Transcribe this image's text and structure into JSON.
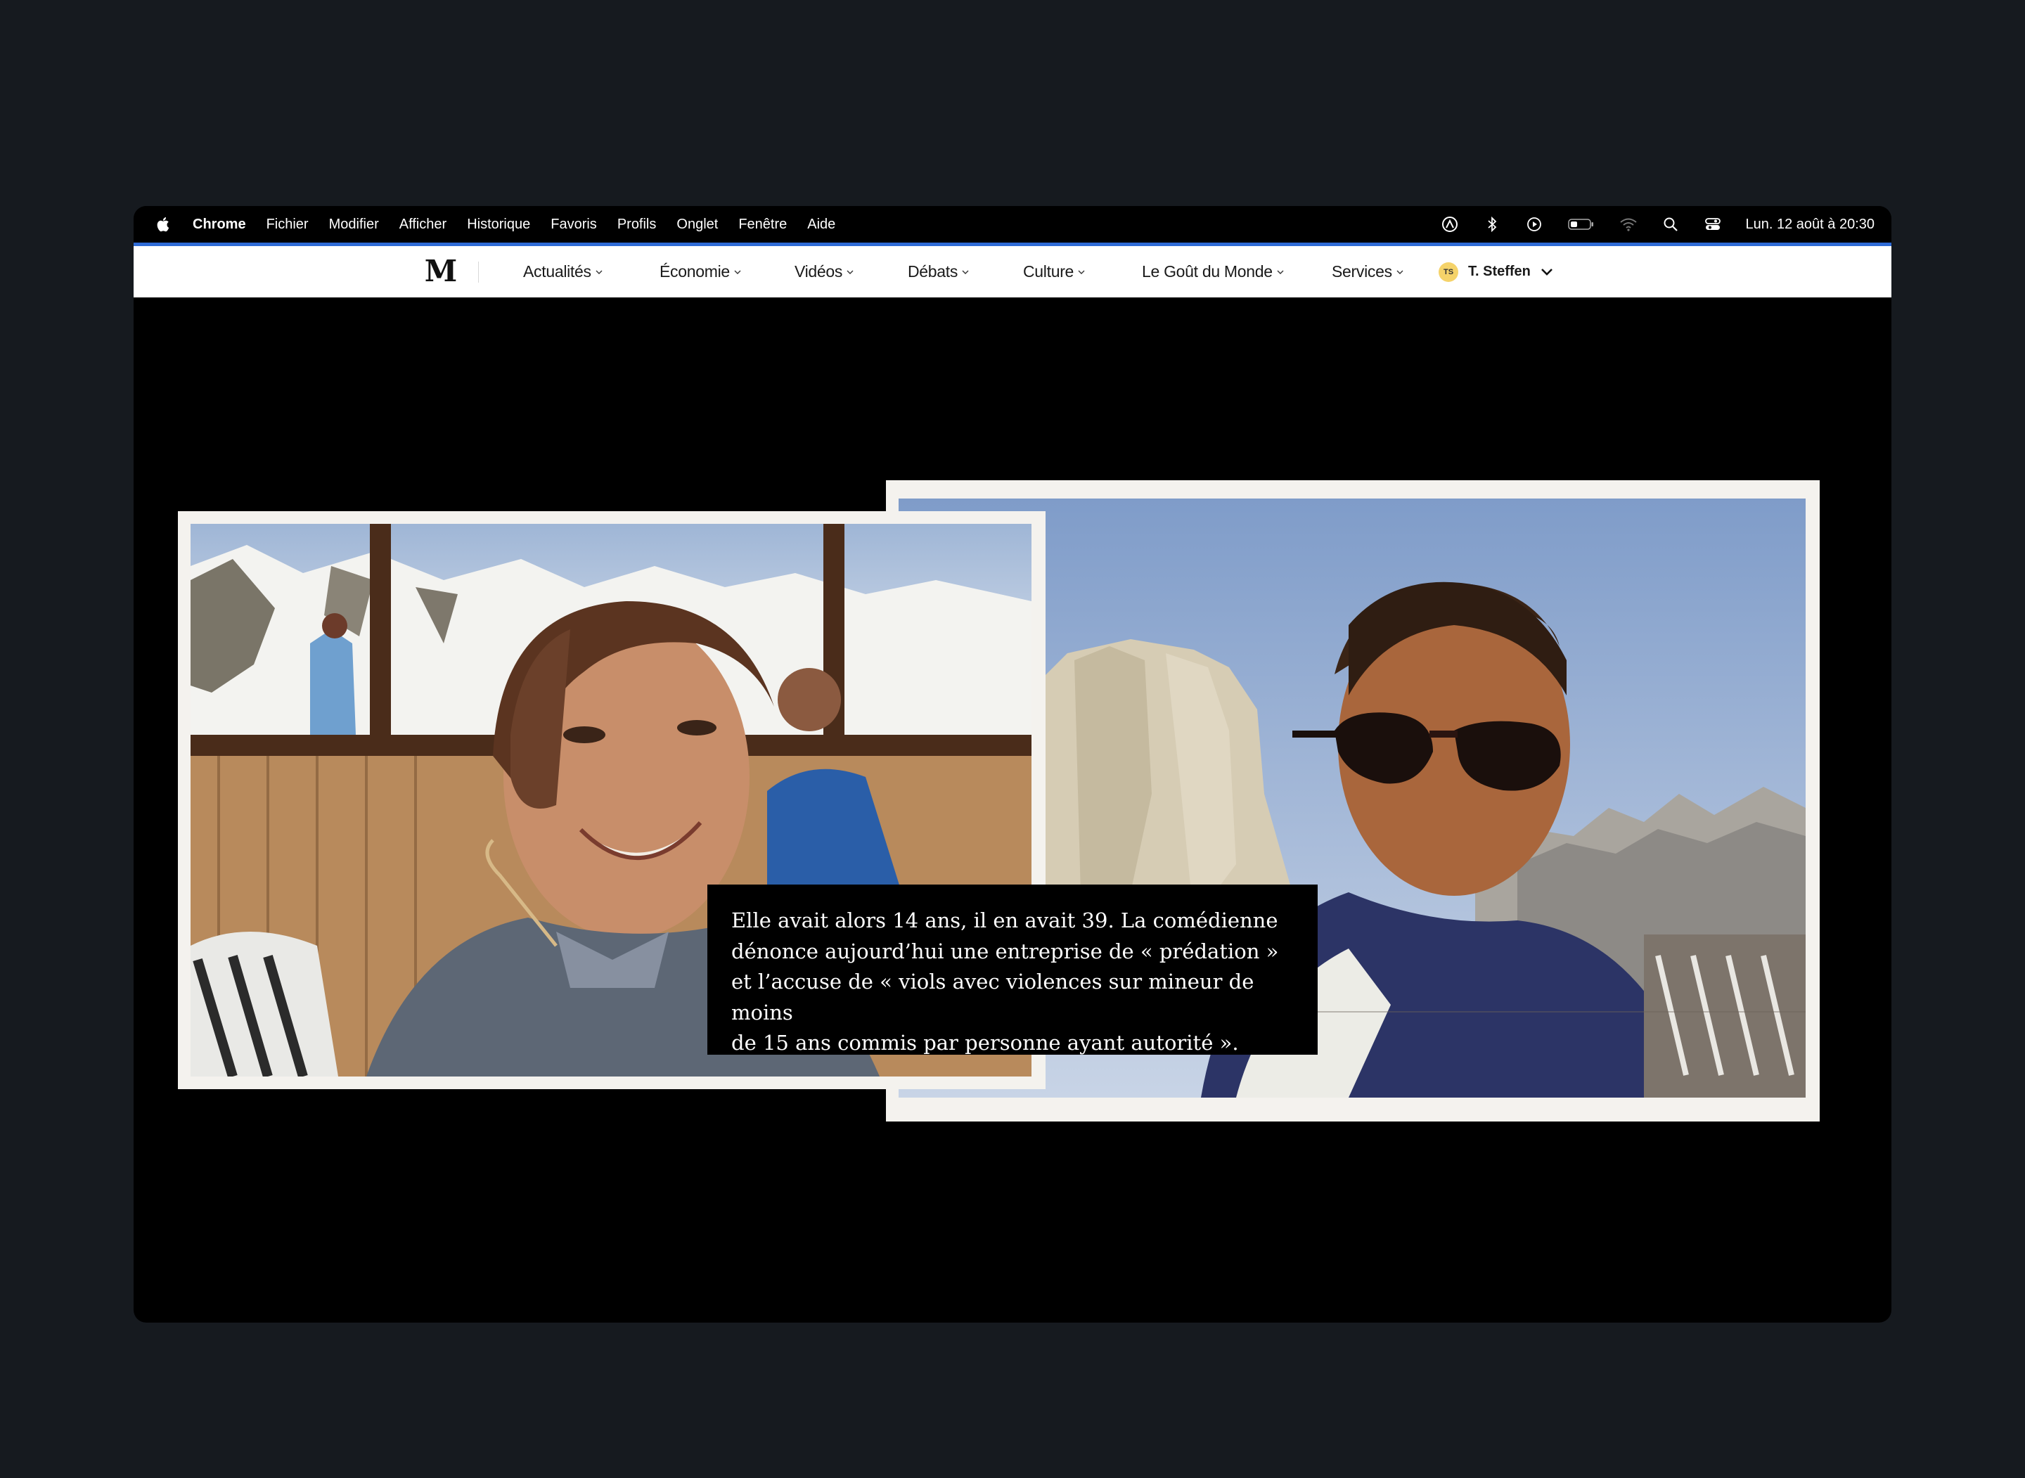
{
  "menubar": {
    "apple_icon": "apple-icon",
    "app_name": "Chrome",
    "items": [
      "Fichier",
      "Modifier",
      "Afficher",
      "Historique",
      "Favoris",
      "Profils",
      "Onglet",
      "Fenêtre",
      "Aide"
    ],
    "status_icons": [
      "screen-record-icon",
      "bluetooth-icon",
      "play-icon",
      "battery-icon",
      "wifi-icon",
      "search-icon",
      "control-center-icon"
    ],
    "clock": "Lun. 12 août à  20:30"
  },
  "site_nav": {
    "logo_letter": "M",
    "items": [
      "Actualités",
      "Économie",
      "Vidéos",
      "Débats",
      "Culture",
      "Le Goût du Monde",
      "Services"
    ],
    "user": {
      "initials": "TS",
      "name": "T. Steffen"
    }
  },
  "article": {
    "left_photo_alt": "young woman smiling in a mountain lodge",
    "right_photo_alt": "man with sunglasses in front of mountain rocks",
    "caption_lines": [
      "Elle avait alors 14 ans, il en avait 39. La comédienne",
      "dénonce aujourd’hui une entreprise de « prédation »",
      "et l’accuse de « viols avec violences sur mineur de moins",
      "de 15 ans commis par personne ayant autorité »."
    ]
  },
  "colors": {
    "accent": "#2e6bd6",
    "avatar": "#f5d36a",
    "background": "#161a1f"
  }
}
